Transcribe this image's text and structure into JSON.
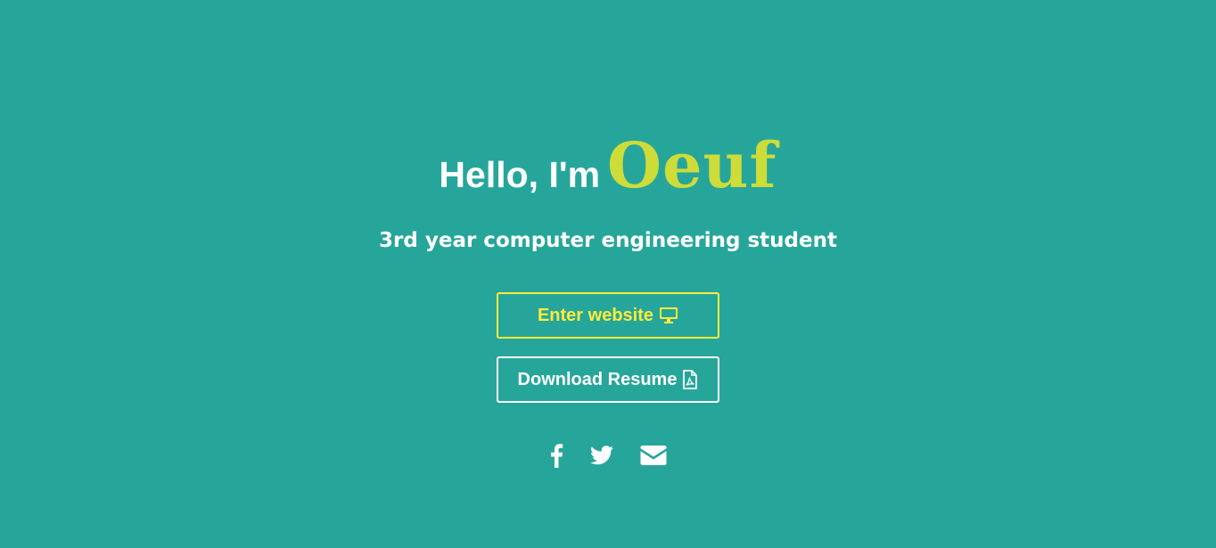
{
  "hero": {
    "greeting": "Hello, I'm",
    "name": "Oeuf",
    "subtitle": "3rd year computer engineering student"
  },
  "buttons": {
    "enter_label": "Enter website",
    "enter_icon": "desktop-icon",
    "resume_label": "Download Resume",
    "resume_icon": "pdf-file-icon"
  },
  "social": [
    "facebook-icon",
    "twitter-icon",
    "envelope-icon"
  ],
  "colors": {
    "background": "#26a69a",
    "name_accent": "#cddc39",
    "enter_accent": "#ffeb3b",
    "text": "#ffffff"
  }
}
